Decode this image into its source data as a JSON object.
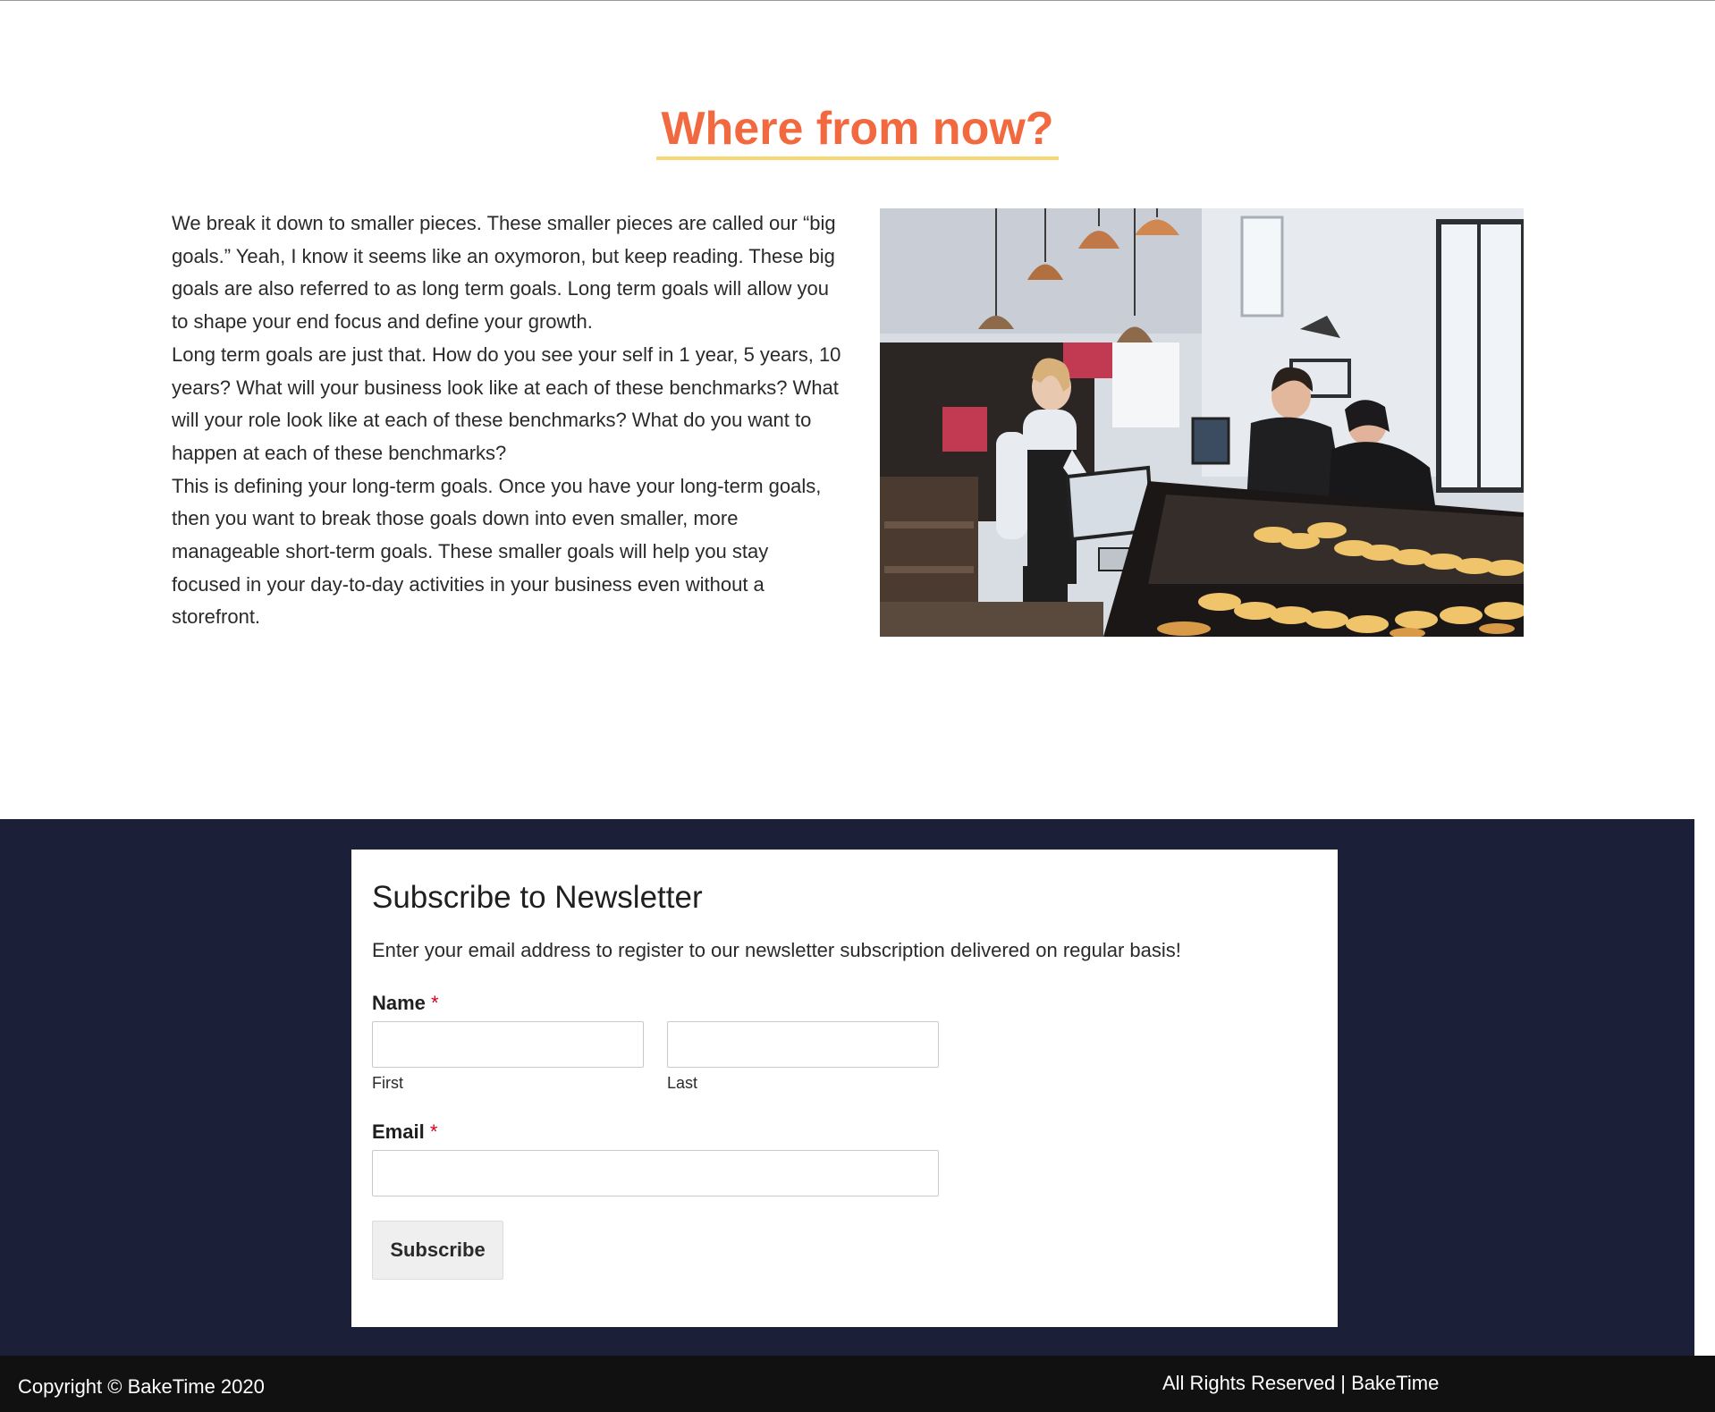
{
  "section": {
    "heading": "Where from now?",
    "paragraphs": [
      "We break it down to smaller pieces. These smaller pieces are called our “big goals.” Yeah, I know it seems like an oxymoron, but keep reading. These big goals are also referred to as long term goals. Long term goals will allow you to shape your end focus and define your growth.",
      "Long term goals are just that. How do you see your self in 1 year, 5 years, 10 years? What will your business look like at each of these benchmarks? What will your role look like at each of these benchmarks? What do you want to happen at each of these benchmarks?",
      "This is defining your long-term goals. Once you have your long-term goals, then you want to break those goals down into even smaller, more manageable short-term goals. These smaller goals will help you stay focused in your day-to-day activities in your business even without a storefront."
    ],
    "image_subject": "bakery counter with staff and customers"
  },
  "newsletter": {
    "title": "Subscribe to Newsletter",
    "description": "Enter your email address to register to our newsletter subscription delivered on regular basis!",
    "name_label": "Name",
    "required_mark": "*",
    "first_sublabel": "First",
    "last_sublabel": "Last",
    "first_value": "",
    "last_value": "",
    "email_label": "Email",
    "email_value": "",
    "subscribe_label": "Subscribe"
  },
  "footer": {
    "copyright": "Copyright © BakeTime 2020",
    "rights": "All Rights Reserved | BakeTime"
  },
  "colors": {
    "heading": "#f2683f",
    "heading_underline": "#f6d775",
    "band_background": "#1b2038",
    "footer_background": "#111111",
    "required": "#d0021b"
  }
}
